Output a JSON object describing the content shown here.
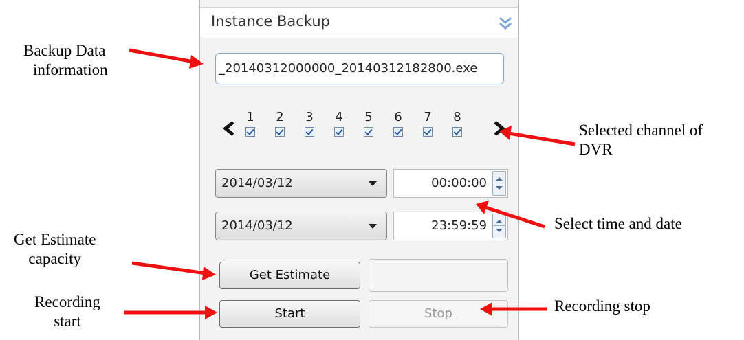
{
  "panel": {
    "title": "Instance Backup",
    "backup_filename": "_20140312000000_20140312182800.exe",
    "channels": [
      {
        "number": "1",
        "checked": true
      },
      {
        "number": "2",
        "checked": true
      },
      {
        "number": "3",
        "checked": true
      },
      {
        "number": "4",
        "checked": true
      },
      {
        "number": "5",
        "checked": true
      },
      {
        "number": "6",
        "checked": true
      },
      {
        "number": "7",
        "checked": true
      },
      {
        "number": "8",
        "checked": true
      }
    ],
    "start_date": "2014/03/12",
    "start_time": "00:00:00",
    "end_date": "2014/03/12",
    "end_time": "23:59:59",
    "get_estimate_label": "Get Estimate",
    "estimate_value": "",
    "start_label": "Start",
    "stop_label": "Stop"
  },
  "annotations": {
    "backup_data_info": [
      "Backup Data",
      "information"
    ],
    "selected_channel": [
      "Selected channel of",
      "DVR"
    ],
    "select_time_date": "Select time and date",
    "get_estimate_capacity": [
      "Get Estimate",
      "capacity"
    ],
    "recording_start": [
      "Recording",
      "start"
    ],
    "recording_stop": "Recording stop"
  },
  "colors": {
    "annotation_arrow": "#ee1111",
    "collapse_icon": "#7aa3d8"
  },
  "icons": {
    "collapse": "double-chevron-down-icon",
    "prev": "chevron-left-icon",
    "next": "chevron-right-icon"
  }
}
